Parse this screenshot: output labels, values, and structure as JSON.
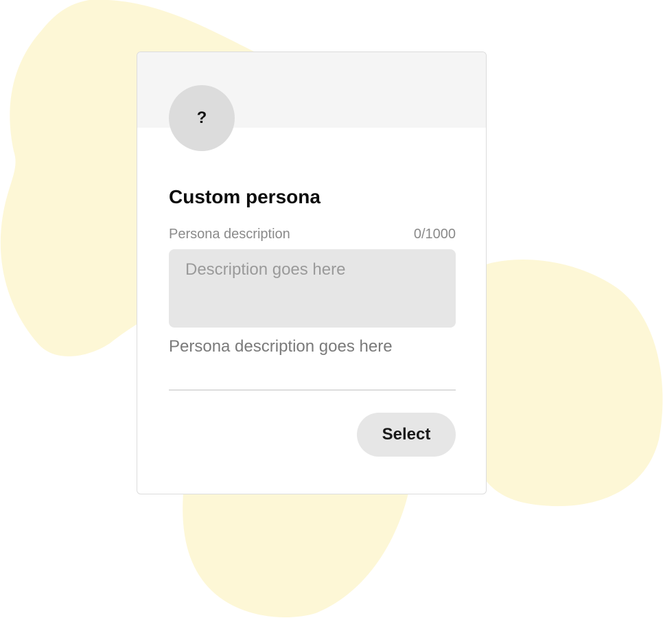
{
  "colors": {
    "blob": "#fdf7d6",
    "card_header": "#f5f5f5",
    "avatar": "#dcdcdc",
    "input_bg": "#e6e6e6",
    "button_bg": "#e6e6e6"
  },
  "card": {
    "avatar_symbol": "?",
    "title": "Custom persona",
    "field_label": "Persona description",
    "char_counter": "0/1000",
    "input": {
      "value": "",
      "placeholder": "Description goes here"
    },
    "description_text": "Persona description goes here",
    "select_label": "Select"
  }
}
